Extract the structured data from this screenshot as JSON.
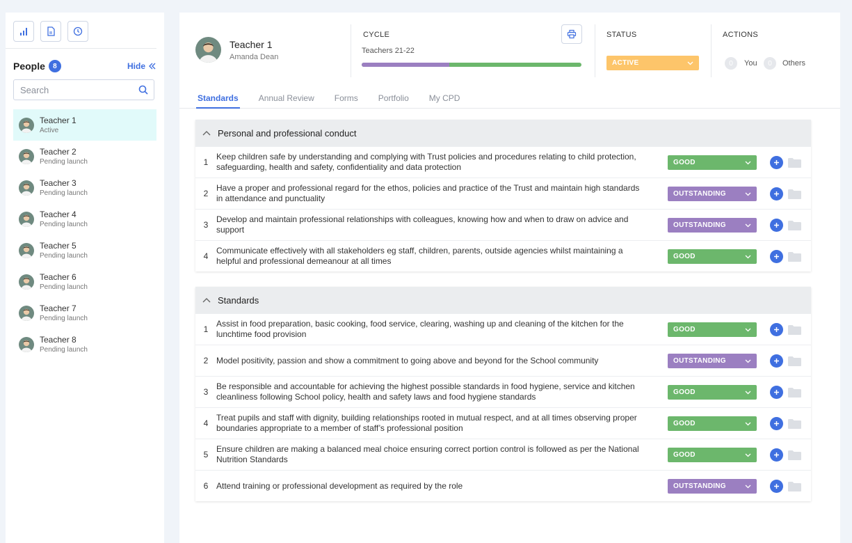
{
  "colors": {
    "accent": "#3f6fe0",
    "good": "#6cb76c",
    "outstanding": "#9b7fc1",
    "active_status": "#fdc56a"
  },
  "sidebar": {
    "tools": [
      {
        "icon": "bar-chart-icon"
      },
      {
        "icon": "document-icon"
      },
      {
        "icon": "clock-icon"
      }
    ],
    "people_label": "People",
    "people_count": "8",
    "hide_label": "Hide",
    "search_placeholder": "Search",
    "people": [
      {
        "name": "Teacher 1",
        "status": "Active"
      },
      {
        "name": "Teacher 2",
        "status": "Pending launch"
      },
      {
        "name": "Teacher 3",
        "status": "Pending launch"
      },
      {
        "name": "Teacher 4",
        "status": "Pending launch"
      },
      {
        "name": "Teacher 5",
        "status": "Pending launch"
      },
      {
        "name": "Teacher 6",
        "status": "Pending launch"
      },
      {
        "name": "Teacher 7",
        "status": "Pending launch"
      },
      {
        "name": "Teacher 8",
        "status": "Pending launch"
      }
    ]
  },
  "header": {
    "teacher_name": "Teacher 1",
    "teacher_sub": "Amanda Dean",
    "cycle_label": "CYCLE",
    "cycle_name": "Teachers 21-22",
    "cycle_progress": 0.4,
    "status_label": "STATUS",
    "status_value": "ACTIVE",
    "actions_label": "ACTIONS",
    "actions_you_count": "0",
    "actions_you_label": "You",
    "actions_others_count": "0",
    "actions_others_label": "Others"
  },
  "tabs": [
    "Standards",
    "Annual Review",
    "Forms",
    "Portfolio",
    "My CPD"
  ],
  "sections": [
    {
      "title": "Personal and professional conduct",
      "rows": [
        {
          "num": "1",
          "text": "Keep children safe by understanding and complying with Trust policies and procedures relating to child protection, safeguarding, health and safety, confidentiality and data protection",
          "rating": "GOOD"
        },
        {
          "num": "2",
          "text": "Have a proper and professional regard for the ethos, policies and practice of the Trust and maintain high standards in attendance and punctuality",
          "rating": "OUTSTANDING"
        },
        {
          "num": "3",
          "text": "Develop and maintain professional relationships with colleagues, knowing how and when to draw on advice and support",
          "rating": "OUTSTANDING"
        },
        {
          "num": "4",
          "text": "Communicate effectively with all stakeholders eg staff, children, parents, outside agencies whilst maintaining a helpful and professional demeanour at all times",
          "rating": "GOOD"
        }
      ]
    },
    {
      "title": "Standards",
      "rows": [
        {
          "num": "1",
          "text": "Assist in food preparation, basic cooking, food service, clearing, washing up and cleaning of the kitchen for the lunchtime food provision",
          "rating": "GOOD"
        },
        {
          "num": "2",
          "text": "Model positivity, passion and show a commitment to going above and beyond for the School community",
          "rating": "OUTSTANDING"
        },
        {
          "num": "3",
          "text": "Be responsible and accountable for achieving the highest possible standards in food hygiene, service and kitchen cleanliness following School policy, health and safety laws and food hygiene standards",
          "rating": "GOOD"
        },
        {
          "num": "4",
          "text": "Treat pupils and staff with dignity, building relationships rooted in mutual respect, and at all times observing proper boundaries appropriate to a member of staff’s professional position",
          "rating": "GOOD"
        },
        {
          "num": "5",
          "text": "Ensure children are making a balanced meal choice ensuring correct portion control is followed as per the National Nutrition Standards",
          "rating": "GOOD"
        },
        {
          "num": "6",
          "text": "Attend training or professional development as required by the role",
          "rating": "OUTSTANDING"
        }
      ]
    }
  ]
}
